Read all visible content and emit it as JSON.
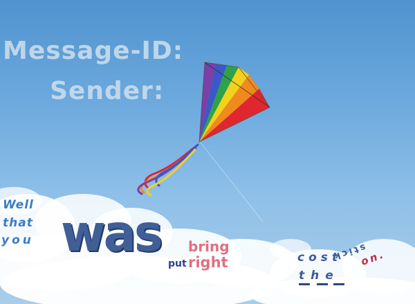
{
  "header": {
    "line1": "Message-ID:",
    "line2": "Sender:"
  },
  "words": {
    "well": "Well",
    "that": "that",
    "you": "you",
    "was": "was",
    "bring": "bring",
    "put": "put",
    "right": "right",
    "cost": "cost",
    "the": "the",
    "stick": "stick",
    "on": "on."
  },
  "kite": {
    "colors": [
      "#7b3fa8",
      "#3b57c8",
      "#2da24a",
      "#f2d21c",
      "#f08a1c",
      "#e0262e"
    ]
  }
}
